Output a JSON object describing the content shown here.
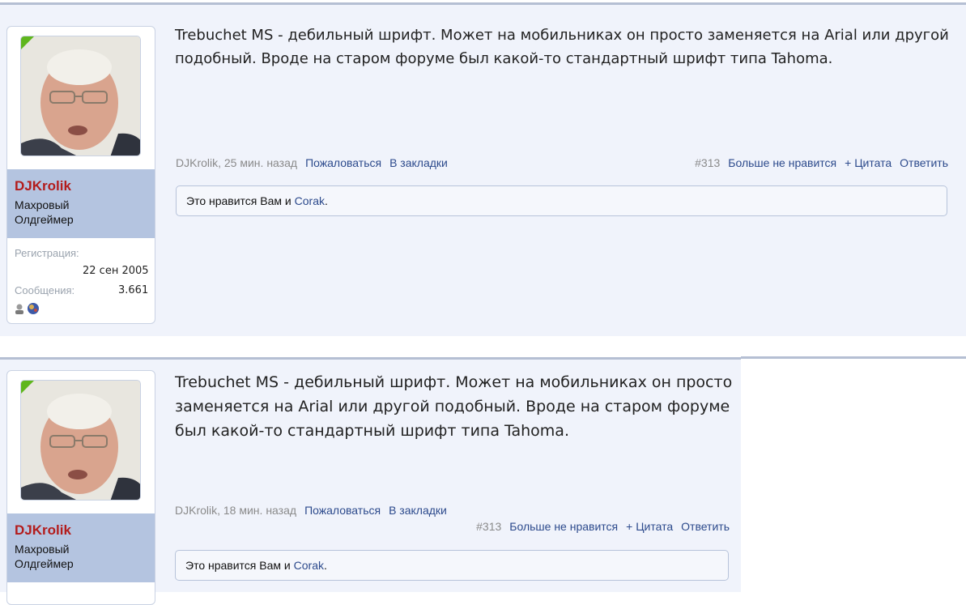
{
  "posts": [
    {
      "username": "DJKrolik",
      "user_title": "Махровый Олдгеймер",
      "reg_label": "Регистрация:",
      "reg_date": "22 сен 2005",
      "msgs_label": "Сообщения:",
      "msgs_count": "3.661",
      "message": "Trebuchet MS - дебильный шрифт. Может на мобильниках он просто заменяется на Arial или другой подобный. Вроде на старом форуме был какой-то стандартный шрифт типа Tahoma.",
      "meta_author_time": "DJKrolik, 25 мин. назад",
      "report": "Пожаловаться",
      "bookmark": "В закладки",
      "post_number": "#313",
      "unlike": "Больше не нравится",
      "quote": "+ Цитата",
      "reply": "Ответить",
      "likes_prefix": "Это нравится Вам и ",
      "likes_user": "Corak",
      "likes_suffix": "."
    },
    {
      "username": "DJKrolik",
      "user_title": "Махровый Олдгеймер",
      "message": "Trebuchet MS - дебильный шрифт. Может на мобильниках он просто заменяется на Arial или другой подобный. Вроде на старом форуме был какой-то стандартный шрифт типа Tahoma.",
      "meta_author_time": "DJKrolik, 18 мин. назад",
      "report": "Пожаловаться",
      "bookmark": "В закладки",
      "post_number": "#313",
      "unlike": "Больше не нравится",
      "quote": "+ Цитата",
      "reply": "Ответить",
      "likes_prefix": "Это нравится Вам и ",
      "likes_user": "Corak",
      "likes_suffix": "."
    }
  ],
  "colors": {
    "username": "#b31c1c",
    "link": "#2c4a8c",
    "user_bar": "#b4c4e0",
    "post_bg": "#f0f3fb",
    "corner_badge": "#5fb61d"
  }
}
